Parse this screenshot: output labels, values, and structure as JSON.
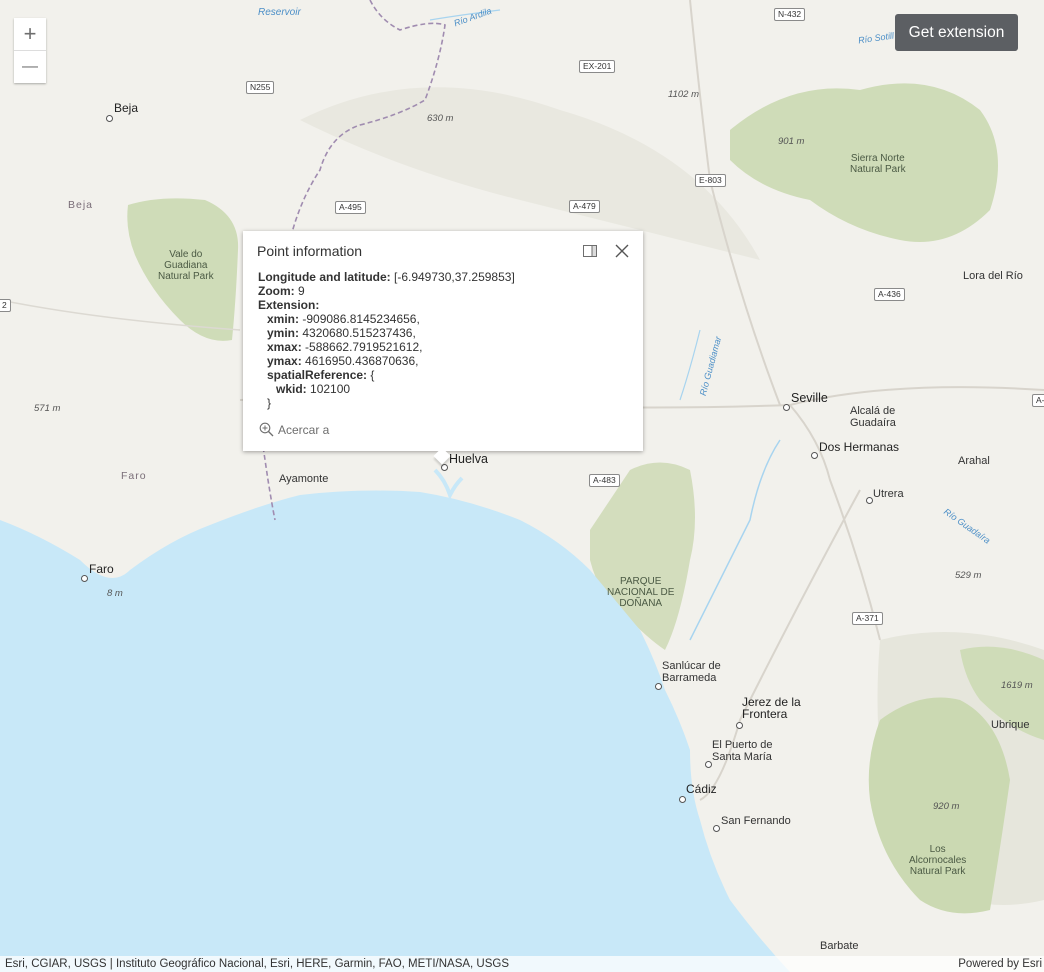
{
  "map": {
    "places": {
      "beja_city": "Beja",
      "beja_region": "Beja",
      "faro_region": "Faro",
      "faro_city": "Faro",
      "huelva": "Huelva",
      "ayamonte": "Ayamonte",
      "seville": "Seville",
      "alcala": "Alcalá de\nGuadaíra",
      "dos_hermanas": "Dos Hermanas",
      "arahal": "Arahal",
      "utrera": "Utrera",
      "lora": "Lora del Río",
      "sanlucar": "Sanlúcar de\nBarrameda",
      "jerez": "Jerez de la\nFrontera",
      "puerto": "El Puerto de\nSanta María",
      "cadiz": "Cádiz",
      "san_fernando": "San Fernando",
      "ubrique": "Ubrique",
      "barbate": "Barbate"
    },
    "parks": {
      "guadiana": "Vale do\nGuadiana\nNatural Park",
      "sierra_norte": "Sierra Norte\nNatural Park",
      "donana": "PARQUE\nNACIONAL DE\nDOÑANA",
      "alcornocales": "Los\nAlcornocales\nNatural Park"
    },
    "peaks": {
      "p1102": "1102 m",
      "p630": "630 m",
      "p901": "901 m",
      "p571": "571 m",
      "p8": "8 m",
      "p529": "529 m",
      "p1619": "1619 m",
      "p920": "920 m"
    },
    "waters": {
      "reservoir": "Reservoir",
      "rio_ardila": "Río Ardila",
      "rio_sotillo": "Río Sotill",
      "rio_guadiamar": "Río Guadiamar",
      "rio_guadaira": "Río Guadaíra"
    },
    "roads": {
      "n432": "N-432",
      "ex201": "EX-201",
      "n255": "N255",
      "e803": "E-803",
      "a495": "A-495",
      "a479": "A-479",
      "a436": "A-436",
      "a483": "A-483",
      "a371": "A-371",
      "edge_left": "2",
      "edge_right": "A-"
    }
  },
  "zoom_controls": {
    "zoom_in": "+",
    "zoom_out": "—"
  },
  "extension_button": {
    "label": "Get extension"
  },
  "popup": {
    "title": "Point information",
    "lonlat_label": "Longitude and latitude:",
    "lonlat_value": "[-6.949730,37.259853]",
    "zoom_label": "Zoom:",
    "zoom_value": "9",
    "extension_label": "Extension:",
    "xmin_label": "xmin:",
    "xmin_value": "-909086.8145234656,",
    "ymin_label": "ymin:",
    "ymin_value": "4320680.515237436,",
    "xmax_label": "xmax:",
    "xmax_value": "-588662.7919521612,",
    "ymax_label": "ymax:",
    "ymax_value": "4616950.436870636,",
    "sr_label": "spatialReference:",
    "sr_open": "{",
    "wkid_label": "wkid:",
    "wkid_value": "102100",
    "sr_close": "}",
    "zoom_to_label": "Acercar a"
  },
  "attribution": {
    "left": "Esri, CGIAR, USGS | Instituto Geográfico Nacional, Esri, HERE, Garmin, FAO, METI/NASA, USGS",
    "right": "Powered by Esri"
  },
  "colors": {
    "sea": "#c8e8f8",
    "land": "#f2f1ec",
    "park": "#cfdcb8",
    "border": "#a08cb0",
    "button_bg": "#5c5f63"
  }
}
